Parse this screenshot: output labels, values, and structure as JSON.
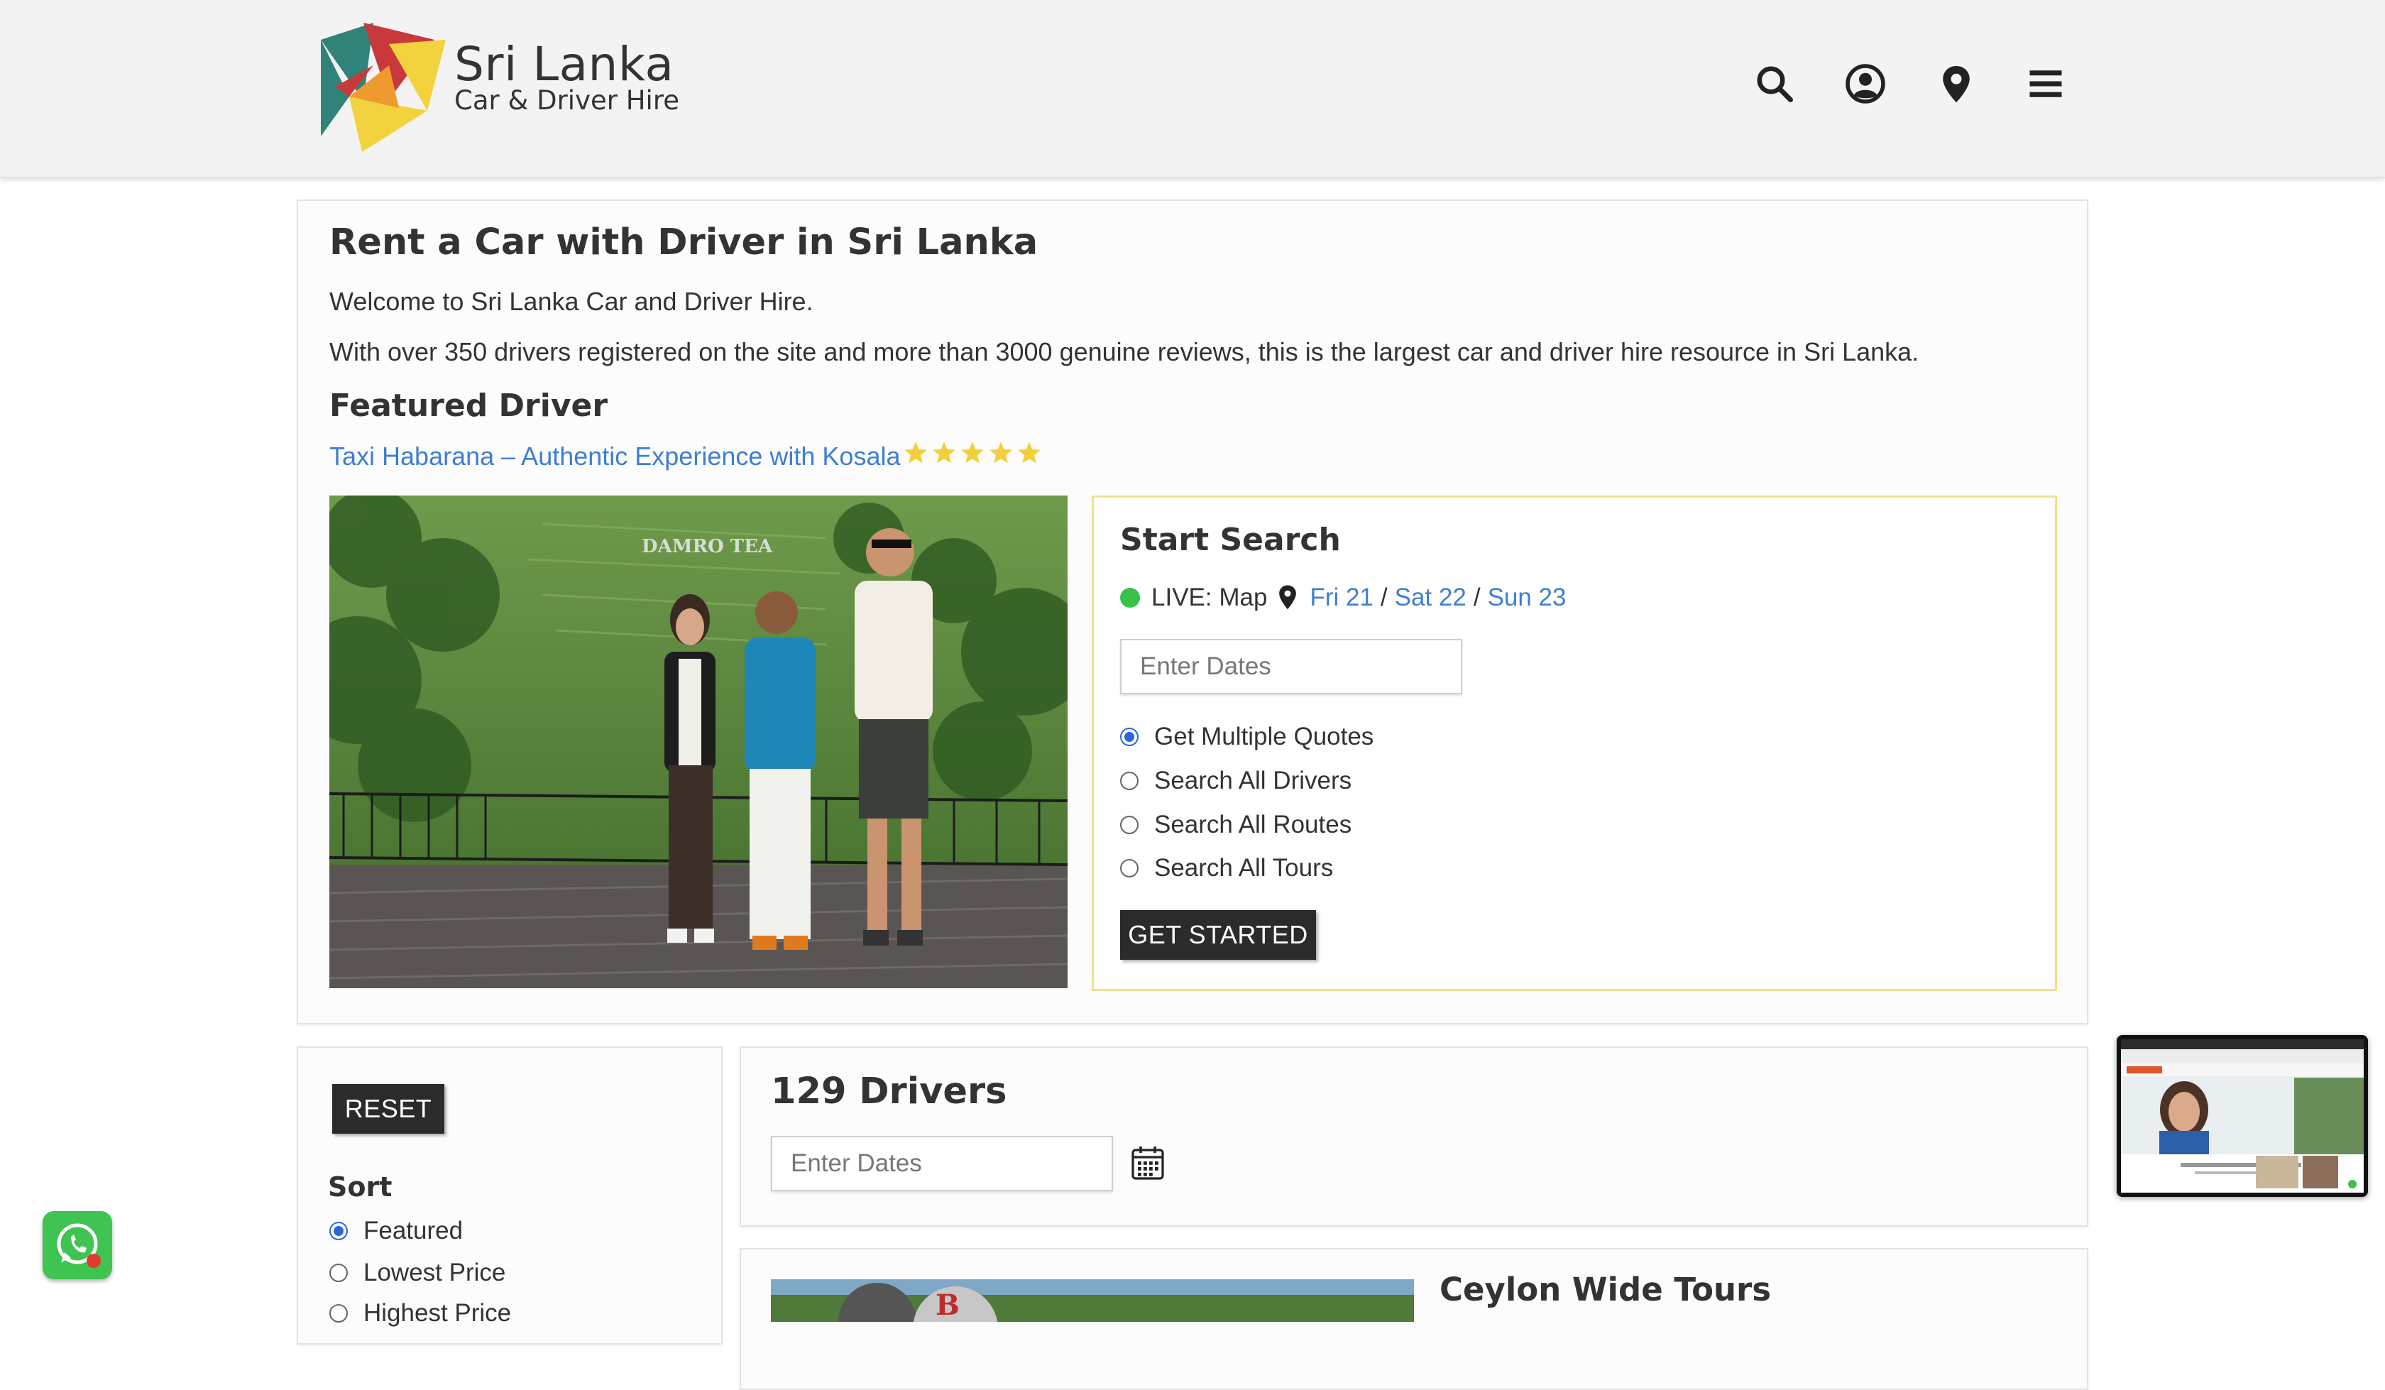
{
  "brand": {
    "title": "Sri Lanka",
    "subtitle": "Car & Driver Hire",
    "colors": {
      "teal": "#2f8378",
      "red": "#c9393b",
      "yellow": "#f2d23d",
      "orange": "#ef9a2f"
    }
  },
  "header": {
    "icons": [
      "search-icon",
      "user-circle-icon",
      "map-pin-icon",
      "menu-icon"
    ]
  },
  "hero": {
    "title": "Rent a Car with Driver in Sri Lanka",
    "welcome": "Welcome to Sri Lanka Car and Driver Hire.",
    "description": "With over 350 drivers registered on the site and more than 3000 genuine reviews, this is the largest car and driver hire resource in Sri Lanka.",
    "featured_heading": "Featured Driver",
    "featured_link": "Taxi Habarana – Authentic Experience with Kosala",
    "featured_rating": 5
  },
  "search": {
    "title": "Start Search",
    "live_label": "LIVE: Map",
    "days": [
      "Fri 21",
      "Sat 22",
      "Sun 23"
    ],
    "date_placeholder": "Enter Dates",
    "options": [
      {
        "label": "Get Multiple Quotes",
        "selected": true
      },
      {
        "label": "Search All Drivers",
        "selected": false
      },
      {
        "label": "Search All Routes",
        "selected": false
      },
      {
        "label": "Search All Tours",
        "selected": false
      }
    ],
    "button_label": "GET STARTED"
  },
  "sidebar": {
    "reset_label": "RESET",
    "sort_heading": "Sort",
    "sort_options": [
      {
        "label": "Featured",
        "selected": true
      },
      {
        "label": "Lowest Price",
        "selected": false
      },
      {
        "label": "Highest Price",
        "selected": false
      }
    ]
  },
  "results": {
    "count_title": "129 Drivers",
    "date_placeholder": "Enter Dates"
  },
  "listing": {
    "title": "Ceylon Wide Tours"
  },
  "colors": {
    "link": "#3d7fd1",
    "accent_border": "#f1e08e",
    "button_dark": "#2b2b2b",
    "live_green": "#36c24b",
    "radio_blue": "#2a66e0",
    "whatsapp": "#3fc351"
  }
}
